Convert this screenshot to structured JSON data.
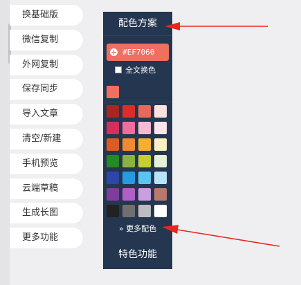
{
  "menu": {
    "items": [
      "换基础版",
      "微信复制",
      "外网复制",
      "保存同步",
      "导入文章",
      "清空/新建",
      "手机预览",
      "云端草稿",
      "生成长图",
      "更多功能"
    ]
  },
  "panel": {
    "title": "配色方案",
    "hex_value": "#EF7060",
    "whole_text_label": "全文换色",
    "current_color": "#EF7060",
    "palette": [
      "#a82521",
      "#d82f28",
      "#e66a5c",
      "#fbe1df",
      "#d52f5d",
      "#ef6e9b",
      "#f6bad3",
      "#fce4ec",
      "#de5b20",
      "#f5892c",
      "#f8af2a",
      "#fdf0c0",
      "#238b21",
      "#8ab43e",
      "#c5cf31",
      "#e6f2d8",
      "#2c47a7",
      "#269be1",
      "#5cc4f0",
      "#b8e4f7",
      "#7d3d9e",
      "#b05fc9",
      "#c99fe0",
      "#bb786c",
      "#222222",
      "#707070",
      "#bdbdbd",
      "#ffffff"
    ],
    "more_colors_label": "更多配色",
    "more_icon": "double-chevron-down-icon",
    "special_label": "特色功能"
  },
  "colors": {
    "panel_bg": "#253650",
    "accent": "#EF7060",
    "arrow": "#e8261e"
  }
}
